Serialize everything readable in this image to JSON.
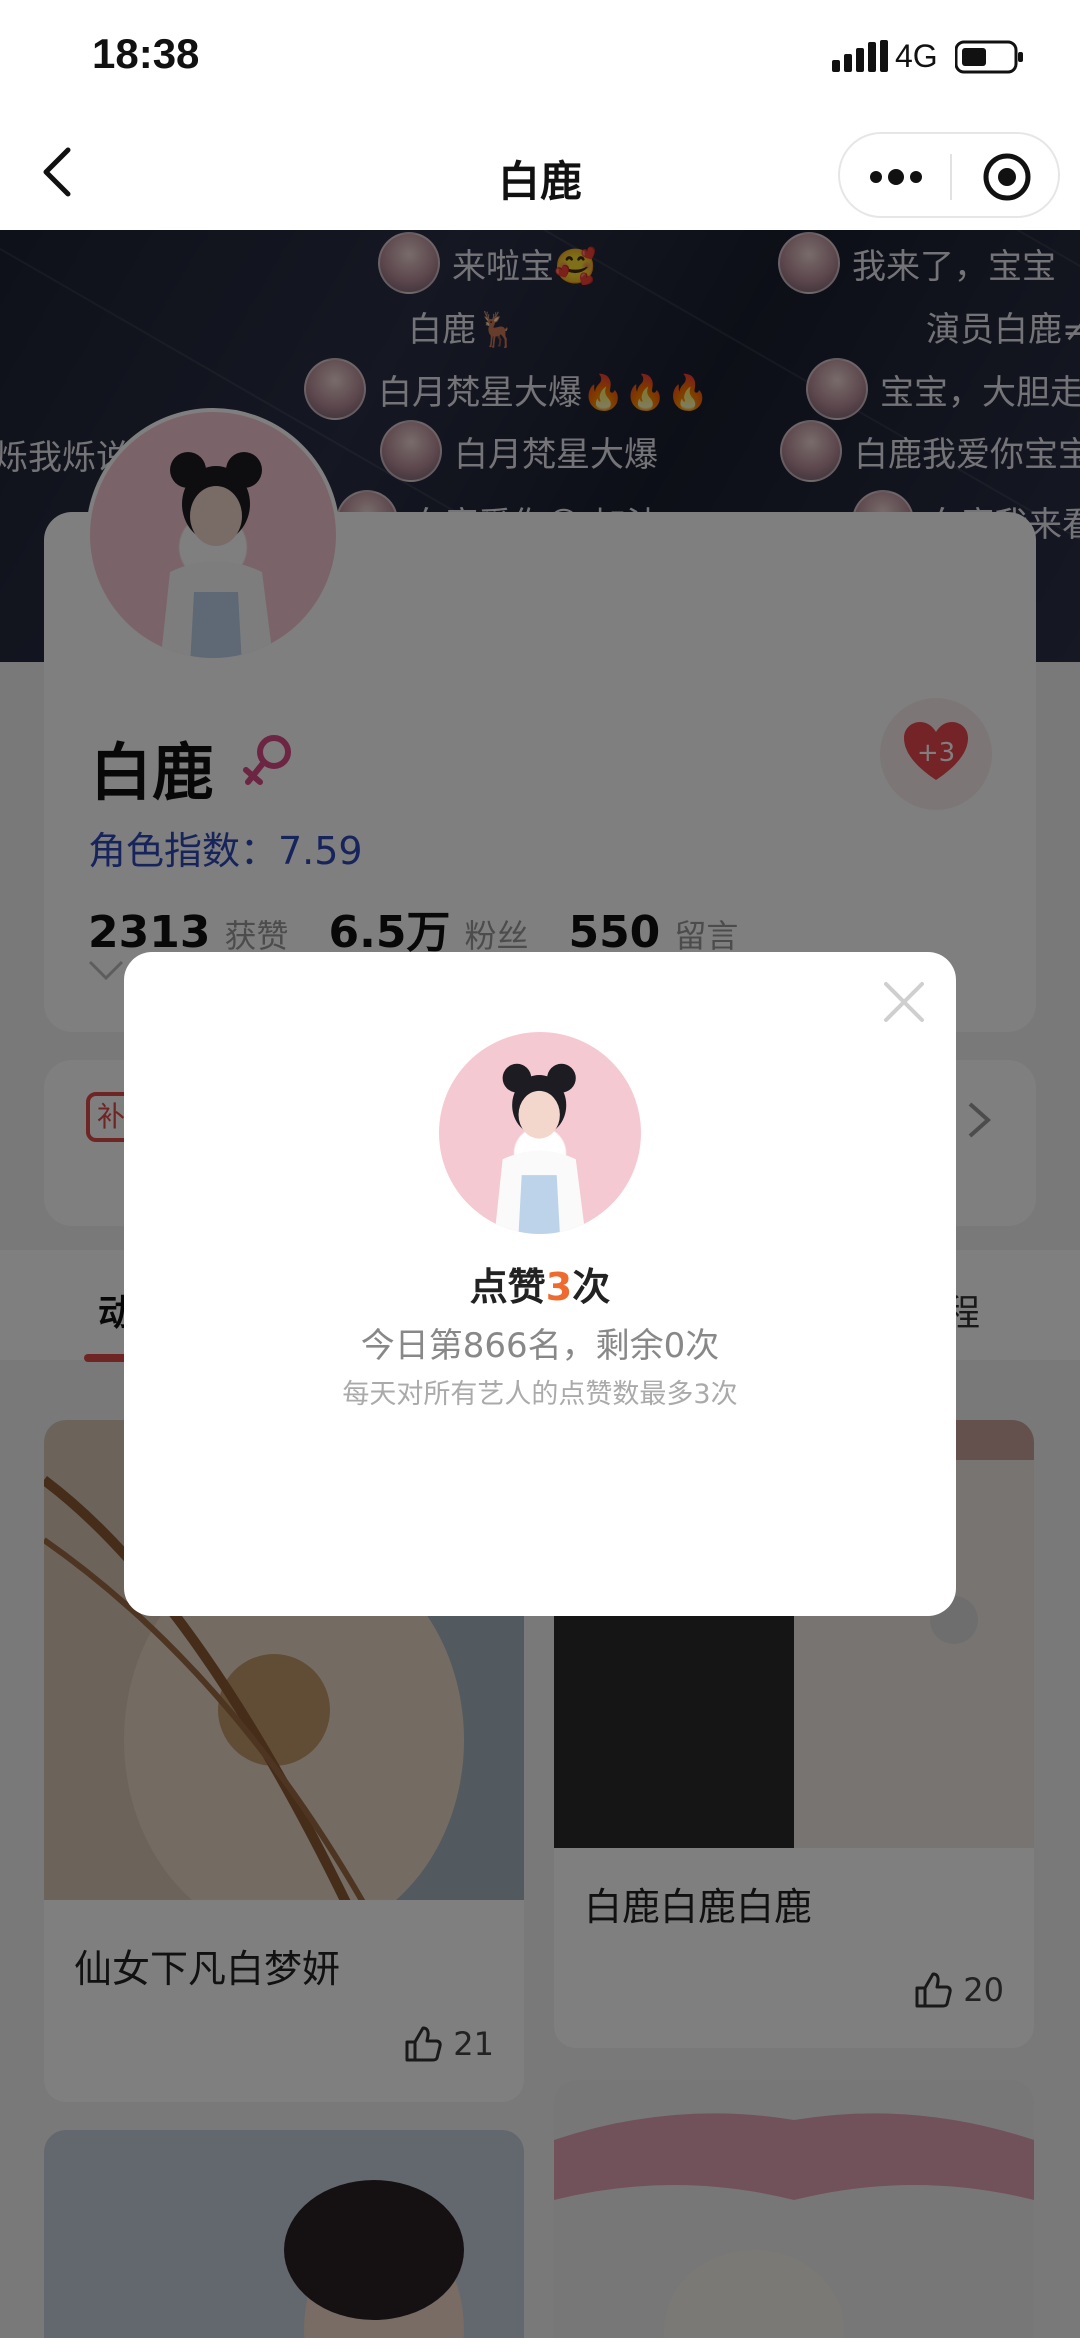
{
  "status_bar": {
    "time": "18:38",
    "network": "4G"
  },
  "nav": {
    "title": "白鹿"
  },
  "danmaku": [
    {
      "text": "来啦宝🥰",
      "avatar": true
    },
    {
      "text": "我来了，宝宝",
      "avatar": true
    },
    {
      "text": "白鹿🦌",
      "avatar": false
    },
    {
      "text": "演员白鹿≠",
      "avatar": false
    },
    {
      "text": "白月梵星大爆🔥🔥🔥",
      "avatar": true
    },
    {
      "text": "宝宝，大胆走",
      "avatar": true
    },
    {
      "text": "烁我烁说",
      "avatar": false
    },
    {
      "text": "白月梵星大爆",
      "avatar": true
    },
    {
      "text": "白鹿我爱你宝宝",
      "avatar": true
    },
    {
      "text": "白鹿爱你😊 加油",
      "avatar": true
    },
    {
      "text": "白鹿我来看",
      "avatar": true
    }
  ],
  "profile": {
    "name": "白鹿",
    "heart_badge": "+3",
    "role_index": "角色指数：7.59",
    "stats": [
      {
        "value": "2313",
        "label": "获赞"
      },
      {
        "value": "6.5万",
        "label": "粉丝"
      },
      {
        "value": "550",
        "label": "留言"
      }
    ]
  },
  "activity": {
    "tag": "补"
  },
  "tabs": {
    "left": "动",
    "right": "程"
  },
  "feed": [
    {
      "title": "仙女下凡白梦妍",
      "likes": "21"
    },
    {
      "title": "白鹿白鹿白鹿",
      "likes": "20"
    }
  ],
  "dialog": {
    "title_prefix": "点赞",
    "title_count": "3",
    "title_suffix": "次",
    "rank": "今日第866名，剩余0次",
    "note": "每天对所有艺人的点赞数最多3次"
  },
  "colors": {
    "accent": "#e14b4b",
    "highlight": "#ef6a2f",
    "role_index": "#2f49b8"
  }
}
